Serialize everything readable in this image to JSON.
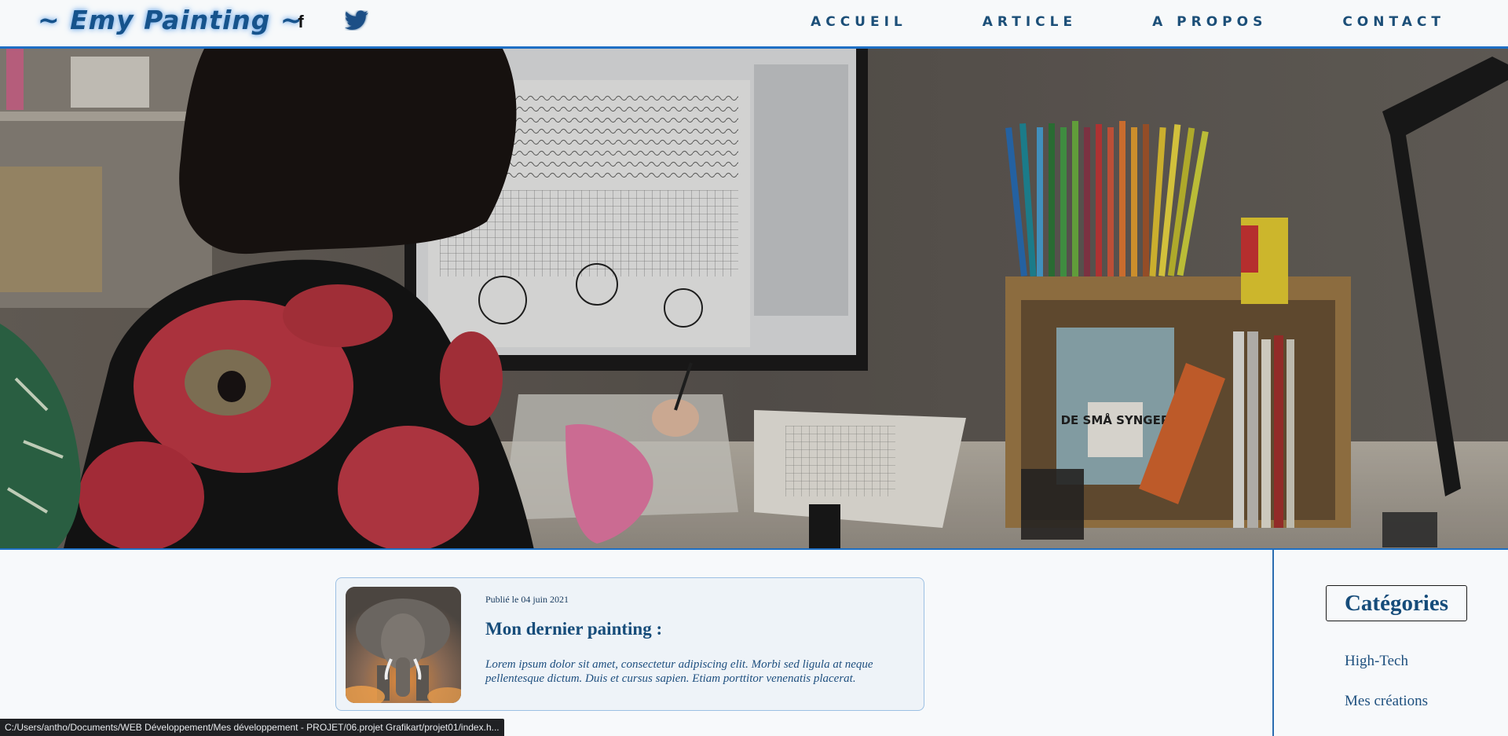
{
  "header": {
    "logo": "~ Emy Painting ~",
    "facebook_glyph": "f",
    "nav": [
      {
        "label": "ACCUEIL"
      },
      {
        "label": "ARTICLE"
      },
      {
        "label": "A PROPOS"
      },
      {
        "label": "CONTACT"
      }
    ]
  },
  "hero": {
    "book_label": "DE SMÅ SYNGER"
  },
  "article": {
    "date": "Publié le 04 juin 2021",
    "title": "Mon dernier painting :",
    "excerpt": "Lorem ipsum dolor sit amet, consectetur adipiscing elit. Morbi sed ligula at neque pellentesque dictum. Duis et cursus sapien. Etiam porttitor venenatis placerat."
  },
  "sidebar": {
    "title": "Catégories",
    "categories": [
      {
        "label": "High-Tech"
      },
      {
        "label": "Mes créations"
      }
    ]
  },
  "status_bar": {
    "url": "C:/Users/antho/Documents/WEB Développement/Mes développement - PROJET/06.projet Grafikart/projet01/index.h..."
  },
  "colors": {
    "accent": "#1e6fc4",
    "title_blue": "#164c7a",
    "logo_blue": "#16538c"
  }
}
